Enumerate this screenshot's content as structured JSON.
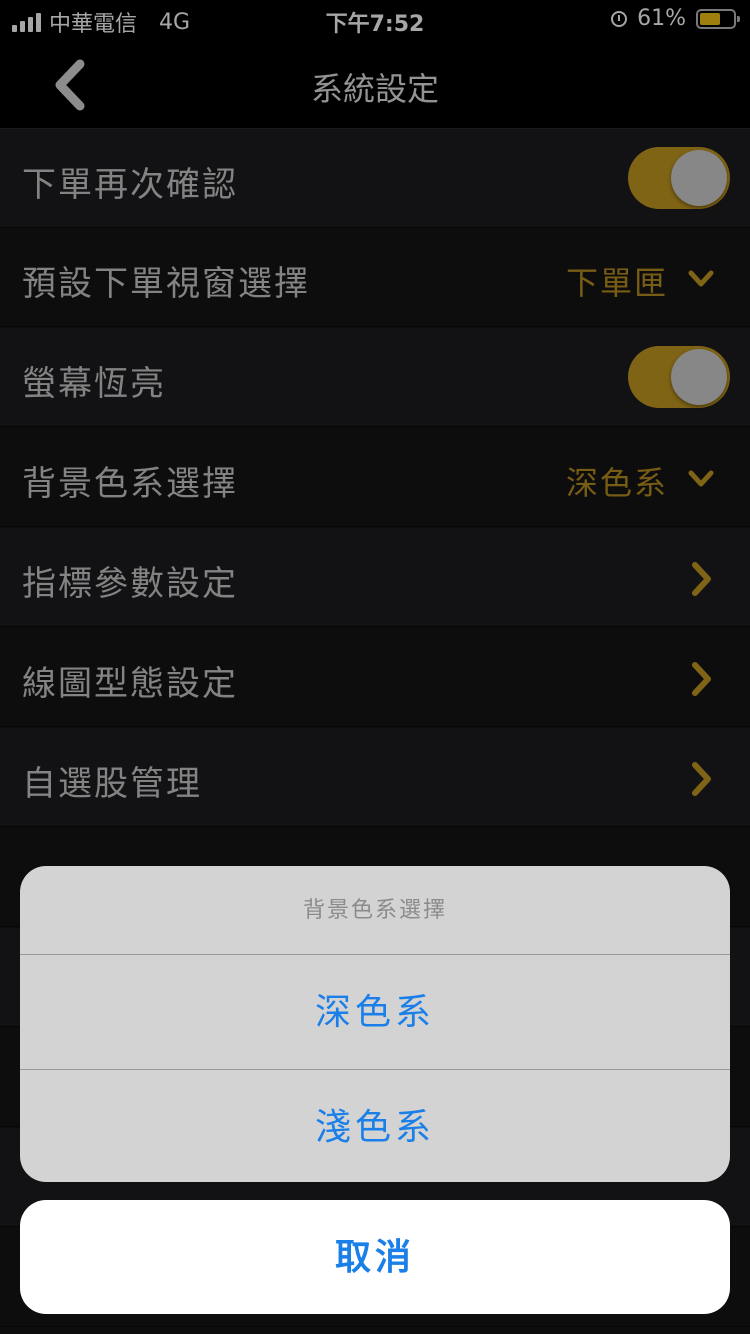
{
  "status_bar": {
    "carrier": "中華電信",
    "network": "4G",
    "time": "下午7:52",
    "battery_text": "61%",
    "battery_level": 0.61,
    "icons": [
      "signal-icon",
      "alarm-icon",
      "battery-icon"
    ]
  },
  "navbar": {
    "title": "系統設定",
    "back_icon": "chevron-left-icon"
  },
  "settings": {
    "order_confirm": {
      "label": "下單再次確認",
      "enabled": true
    },
    "default_order_window": {
      "label": "預設下單視窗選擇",
      "value": "下單匣"
    },
    "screen_always_on": {
      "label": "螢幕恆亮",
      "enabled": true
    },
    "background_theme": {
      "label": "背景色系選擇",
      "value": "深色系"
    },
    "indicator_params": {
      "label": "指標參數設定"
    },
    "chart_style": {
      "label": "線圖型態設定"
    },
    "watchlist": {
      "label": "自選股管理"
    }
  },
  "action_sheet": {
    "title": "背景色系選擇",
    "options": [
      "深色系",
      "淺色系"
    ],
    "cancel": "取消"
  },
  "colors": {
    "accent": "#c49a22",
    "action_blue": "#1a7fe8",
    "background": "#141416"
  }
}
